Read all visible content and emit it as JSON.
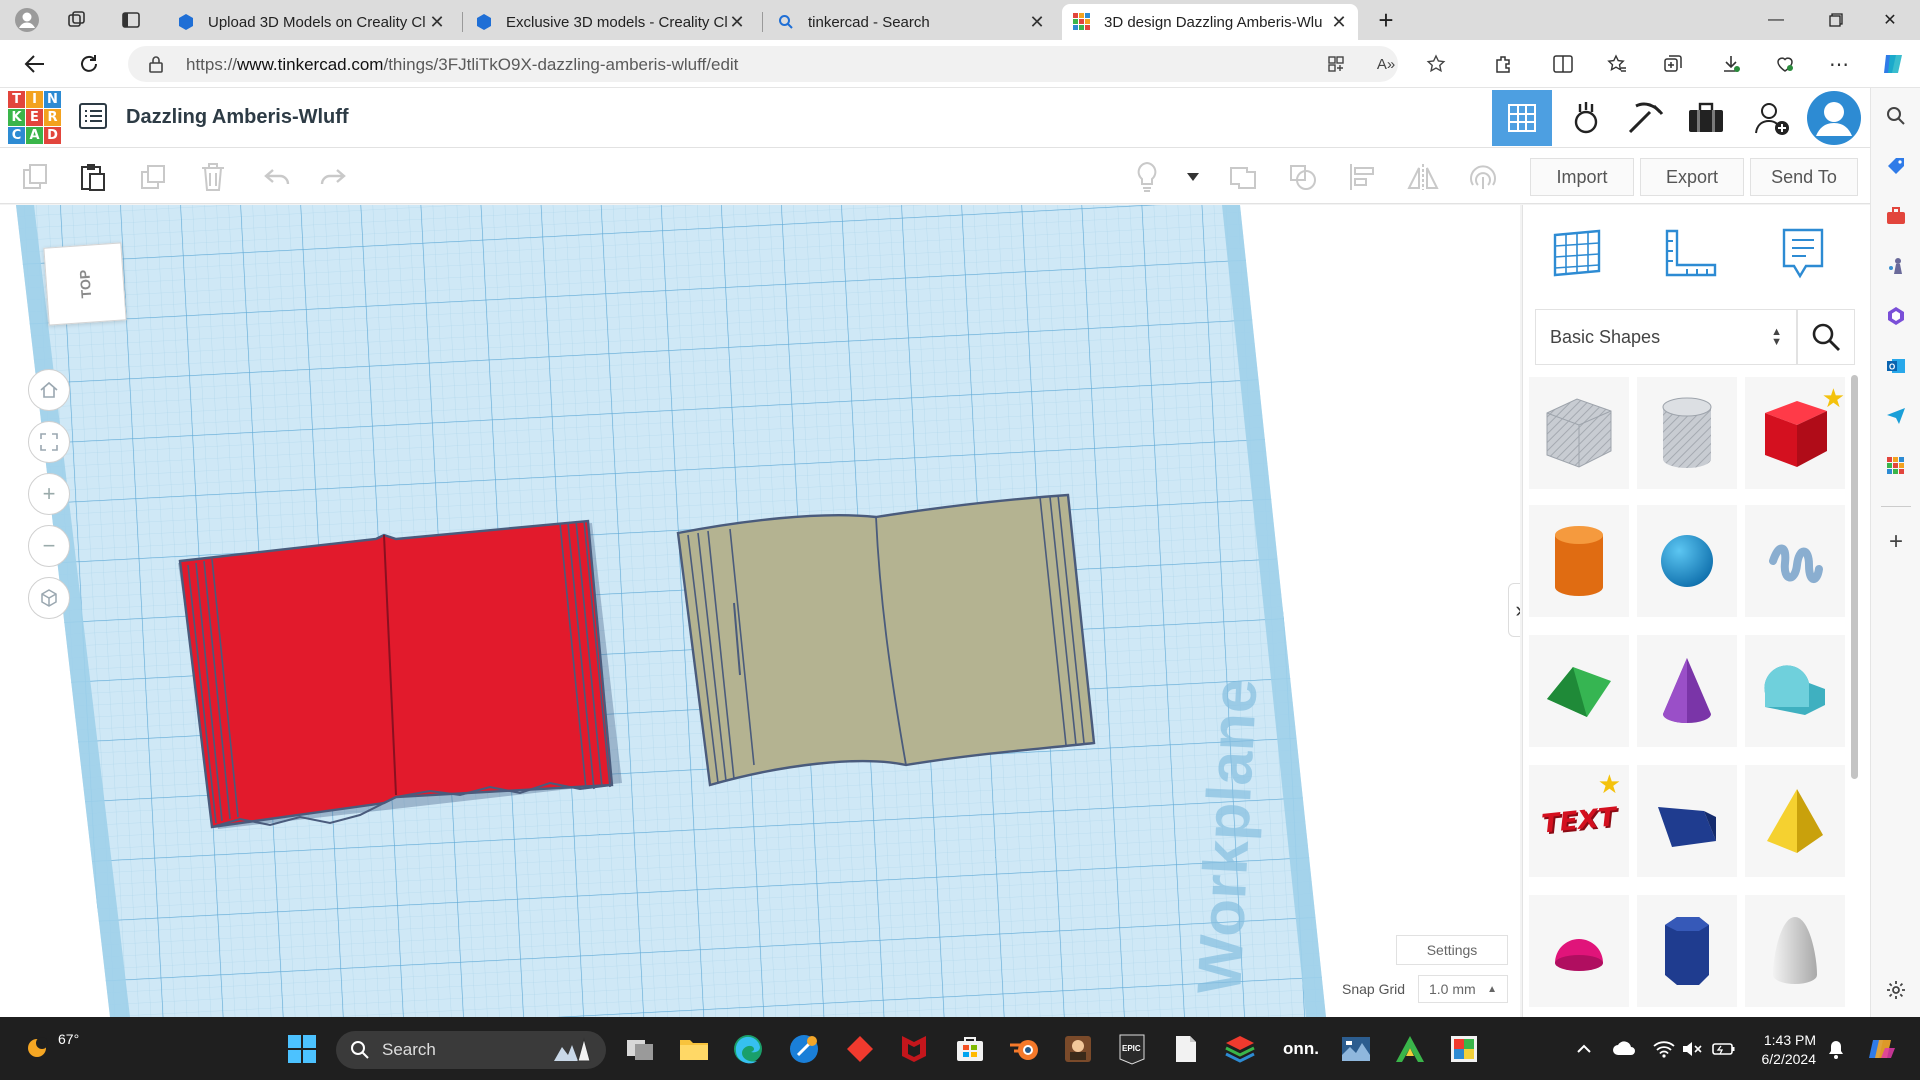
{
  "browser": {
    "tabs": [
      {
        "title": "Upload 3D Models on Creality Cl",
        "icon": "creality-icon"
      },
      {
        "title": "Exclusive 3D models - Creality Cl",
        "icon": "creality-icon"
      },
      {
        "title": "tinkercad - Search",
        "icon": "search-icon"
      },
      {
        "title": "3D design Dazzling Amberis-Wlu",
        "icon": "tinkercad-icon"
      }
    ],
    "url_prefix": "https://",
    "url_domain": "www.tinkercad.com",
    "url_path": "/things/3FJtliTkO9X-dazzling-amberis-wluff/edit"
  },
  "app": {
    "logo_letters": [
      "T",
      "I",
      "N",
      "K",
      "E",
      "R",
      "C",
      "A",
      "D"
    ],
    "logo_colors": [
      "#e2453c",
      "#f3a21f",
      "#2d8bd3",
      "#3ab54a",
      "#e2453c",
      "#f3a21f",
      "#2d8bd3",
      "#3ab54a",
      "#e2453c"
    ],
    "design_title": "Dazzling Amberis-Wluff",
    "accent": "#4d9fe1"
  },
  "toolbar": {
    "import_label": "Import",
    "export_label": "Export",
    "sendto_label": "Send To"
  },
  "workplane": {
    "viewcube_label": "TOP",
    "watermark": "Workplane",
    "settings_label": "Settings",
    "snap_label": "Snap Grid",
    "snap_value": "1.0 mm",
    "objects": [
      {
        "name": "red-book",
        "color": "#e21a2c"
      },
      {
        "name": "tan-book",
        "color": "#b4b391"
      }
    ]
  },
  "panel": {
    "category": "Basic Shapes",
    "shapes": [
      {
        "name": "Box Hole",
        "color": "#b5b9c0",
        "starred": false
      },
      {
        "name": "Cylinder Hole",
        "color": "#c4c7cc",
        "starred": false
      },
      {
        "name": "Box",
        "color": "#e21a2c",
        "starred": true
      },
      {
        "name": "Cylinder",
        "color": "#e8781c",
        "starred": false
      },
      {
        "name": "Sphere",
        "color": "#1a8fd0",
        "starred": false
      },
      {
        "name": "Scribble",
        "color": "#8aaed0",
        "starred": false
      },
      {
        "name": "Roof",
        "color": "#2fa84a",
        "starred": false
      },
      {
        "name": "Cone",
        "color": "#7a35a8",
        "starred": false
      },
      {
        "name": "Round Roof",
        "color": "#4ab7c4",
        "starred": false
      },
      {
        "name": "Text",
        "color": "#e21a2c",
        "starred": true,
        "label": "TEXT"
      },
      {
        "name": "Wedge",
        "color": "#1f3c8f",
        "starred": false
      },
      {
        "name": "Pyramid",
        "color": "#f0c419",
        "starred": false
      },
      {
        "name": "Half Sphere",
        "color": "#e0147a",
        "starred": false
      },
      {
        "name": "Polygon",
        "color": "#1f3c8f",
        "starred": false
      },
      {
        "name": "Paraboloid",
        "color": "#d8d8d8",
        "starred": false
      }
    ]
  },
  "taskbar": {
    "temperature": "67°",
    "search_placeholder": "Search",
    "time": "1:43 PM",
    "date": "6/2/2024",
    "apps": [
      "windows-icon",
      "task-view-icon",
      "file-explorer-icon",
      "edge-icon",
      "copilot-icon",
      "red-app-icon",
      "mcafee-icon",
      "store-icon",
      "blender-icon",
      "game-icon",
      "epic-games-icon",
      "file-icon",
      "stack-icon",
      "onn-app-icon",
      "image-app-icon",
      "arrow-app-icon",
      "paint-icon"
    ],
    "onn_label": "onn.",
    "epic_label": "EPIC"
  }
}
